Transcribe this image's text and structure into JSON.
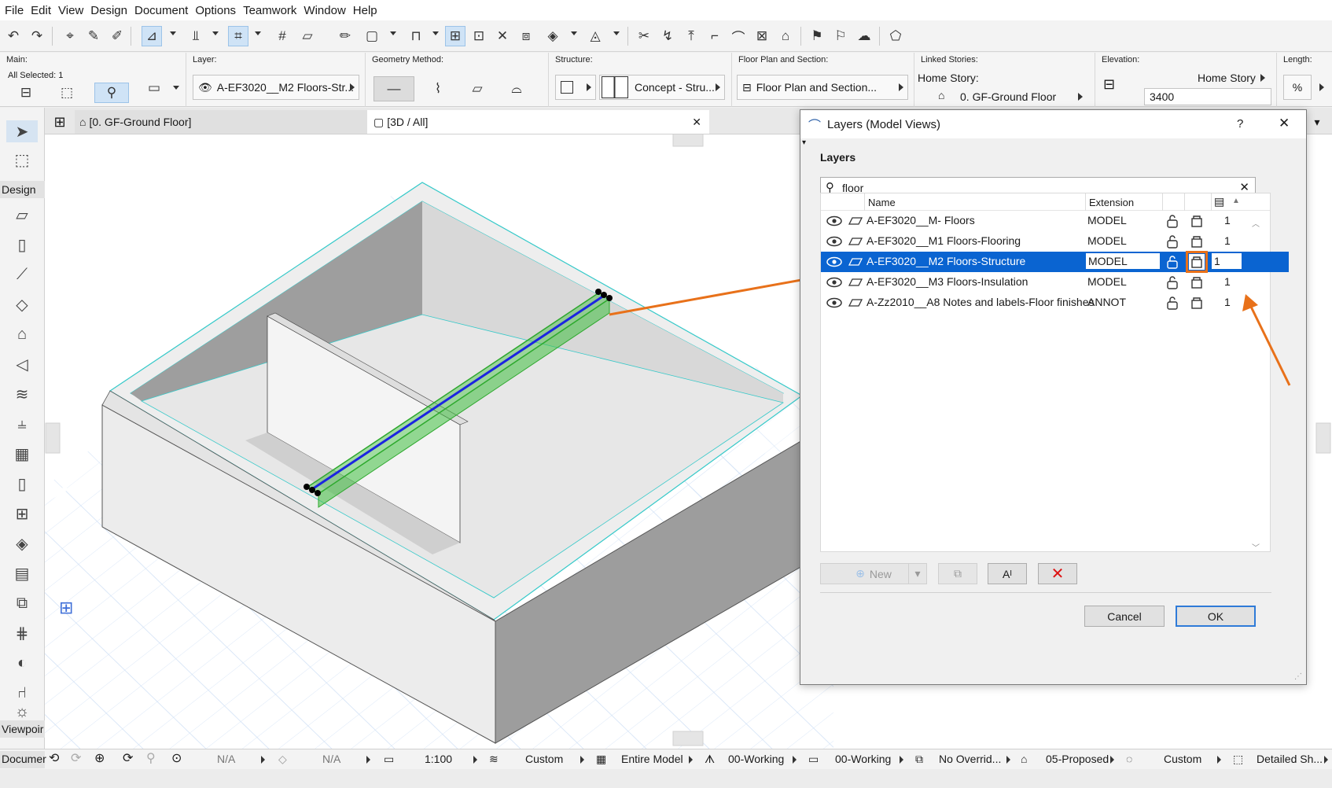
{
  "menu": [
    "File",
    "Edit",
    "View",
    "Design",
    "Document",
    "Options",
    "Teamwork",
    "Window",
    "Help"
  ],
  "infobox": {
    "main_label": "Main:",
    "all_selected": "All Selected: 1",
    "layer_label": "Layer:",
    "layer_value": "A-EF3020__M2 Floors-Str...",
    "geometry_label": "Geometry Method:",
    "structure_label": "Structure:",
    "structure_value": "Concept - Stru...",
    "floorplan_label": "Floor Plan and Section:",
    "floorplan_value": "Floor Plan and Section...",
    "linked_label": "Linked Stories:",
    "home_story_label": "Home Story:",
    "home_story_value": "0. GF-Ground Floor",
    "elevation_label": "Elevation:",
    "elevation_ref": "Home Story",
    "elevation_value": "3400",
    "length_label": "Length:"
  },
  "toolbox": {
    "design_label": "Design",
    "viewpoint_label": "Viewpoir",
    "document_label": "Documer"
  },
  "tabs": [
    {
      "label": "[0. GF-Ground Floor]"
    },
    {
      "label": "[3D / All]"
    }
  ],
  "dialog": {
    "title": "Layers (Model Views)",
    "help": "?",
    "section_title": "Layers",
    "search_value": "floor",
    "columns": {
      "name": "Name",
      "extension": "Extension"
    },
    "rows": [
      {
        "name": "A-EF3020__M- Floors",
        "extension": "MODEL",
        "num": "1",
        "selected": false
      },
      {
        "name": "A-EF3020__M1 Floors-Flooring",
        "extension": "MODEL",
        "num": "1",
        "selected": false
      },
      {
        "name": "A-EF3020__M2 Floors-Structure",
        "extension": "MODEL",
        "num": "1",
        "selected": true
      },
      {
        "name": "A-EF3020__M3 Floors-Insulation",
        "extension": "MODEL",
        "num": "1",
        "selected": false
      },
      {
        "name": "A-Zz2010__A8 Notes and labels-Floor finishes",
        "extension": "ANNOT",
        "num": "1",
        "selected": false
      }
    ],
    "new_label": "New",
    "cancel_label": "Cancel",
    "ok_label": "OK"
  },
  "statusbar": {
    "na1": "N/A",
    "na2": "N/A",
    "scale": "1:100",
    "custom1": "Custom",
    "entire_model": "Entire Model",
    "working1": "00-Working",
    "working2": "00-Working",
    "no_override": "No Overrid...",
    "proposed": "05-Proposed",
    "custom2": "Custom",
    "detailed": "Detailed Sh..."
  },
  "colors": {
    "accent_orange": "#e8711a",
    "selection_blue": "#0a64d1",
    "beam_green": "#3fbf3f",
    "cyan_edge": "#35c9c9"
  }
}
